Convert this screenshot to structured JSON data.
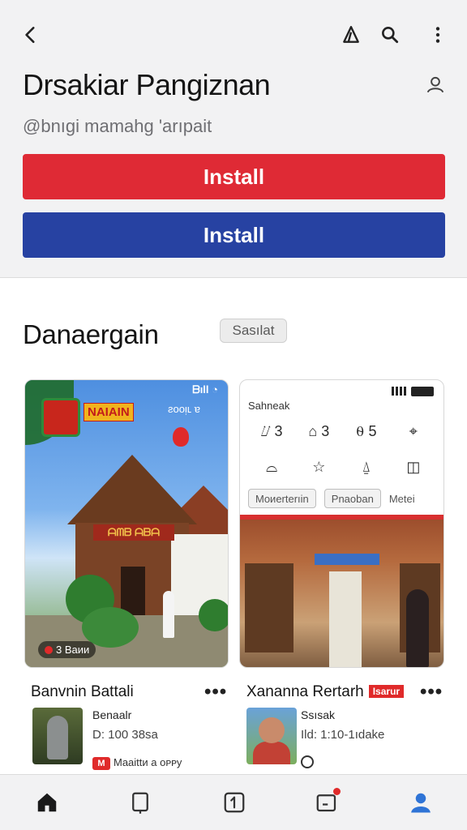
{
  "header": {
    "title": "Drsakiar Pangiznan",
    "handle": "@bnıgi mamahg 'arıpait",
    "icons": [
      "back-arrow-icon",
      "share-icon",
      "search-icon",
      "more-vert-icon",
      "account-icon"
    ]
  },
  "buttons": {
    "primary_label": "Install",
    "secondary_label": "Install",
    "primary_color": "#df2a35",
    "secondary_color": "#2742a2"
  },
  "section": {
    "title": "Danaergain",
    "chip": "Sasılat"
  },
  "cards": [
    {
      "image": {
        "status": "ᗷıll ◔",
        "badge_text": "NAIAIN",
        "subtitle": "ƨooᴉʟ ɐ",
        "sign": "ᗩᗰᗷ ᗩᗷᗩ",
        "counter": "3 Baᴎᴎ"
      },
      "title": "Banvnin Battali",
      "meta_line1": "Benaalr",
      "meta_line2": "D: 100 38sa",
      "meta_line3": "Maaittᴎ a oᴘᴘy",
      "meta_badge": "M",
      "more_label": "•••"
    },
    {
      "image": {
        "label": "Sahneak",
        "grid": [
          "⌰ 3",
          "⌂ 3",
          "⍬ 5",
          "⌖",
          "⌓",
          "☆",
          "⍙",
          "◫"
        ],
        "chip1": "Moᴎerterıin",
        "chip2": "Pnaoban",
        "chip3": "Metei"
      },
      "title": "Xananna Rertarh",
      "title_tag": "Isarur",
      "meta_line1": "Ssısak",
      "meta_line2": "Ild: 1:10-1ıdake",
      "more_label": "•••"
    }
  ],
  "bottom_nav": [
    "home-icon",
    "shorts-icon",
    "add-icon",
    "inbox-icon",
    "you-icon"
  ]
}
